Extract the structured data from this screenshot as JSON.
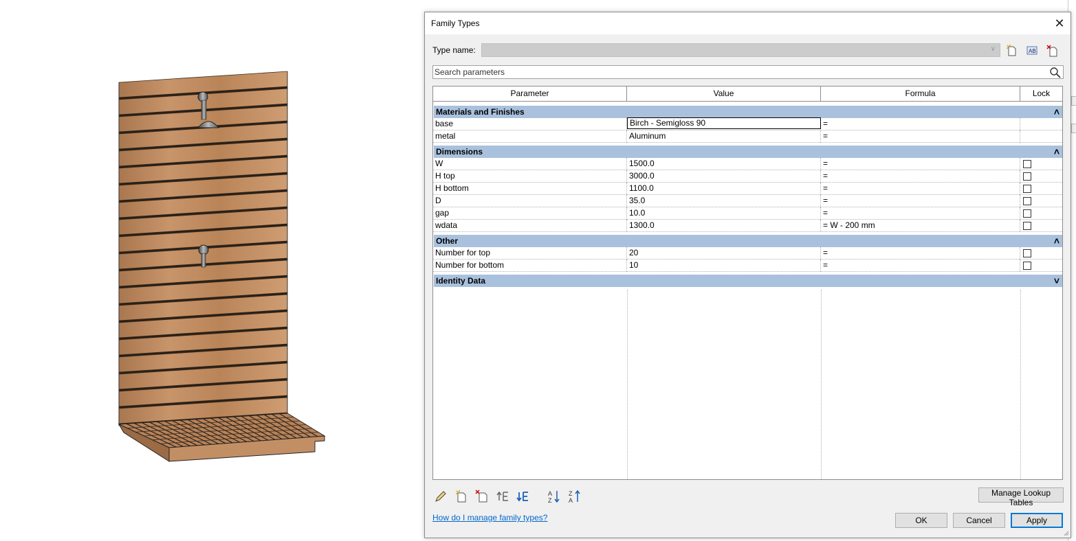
{
  "dialog": {
    "title": "Family Types",
    "close_icon": "close-icon"
  },
  "type_name": {
    "label": "Type name:",
    "value": ""
  },
  "search": {
    "placeholder": "Search parameters"
  },
  "columns": [
    "Parameter",
    "Value",
    "Formula",
    "Lock"
  ],
  "groups": [
    {
      "name": "Materials and Finishes",
      "expanded": true,
      "rows": [
        {
          "parameter": "base",
          "value": "Birch - Semigloss 90",
          "formula": "=",
          "lock": null
        },
        {
          "parameter": "metal",
          "value": "Aluminum",
          "formula": "=",
          "lock": null
        }
      ]
    },
    {
      "name": "Dimensions",
      "expanded": true,
      "rows": [
        {
          "parameter": "W",
          "value": "1500.0",
          "formula": "=",
          "lock": false
        },
        {
          "parameter": "H top",
          "value": "3000.0",
          "formula": "=",
          "lock": false
        },
        {
          "parameter": "H bottom",
          "value": "1100.0",
          "formula": "=",
          "lock": false
        },
        {
          "parameter": "D",
          "value": "35.0",
          "formula": "=",
          "lock": false
        },
        {
          "parameter": "gap",
          "value": "10.0",
          "formula": "=",
          "lock": false
        },
        {
          "parameter": "wdata",
          "value": "1300.0",
          "formula": "= W - 200 mm",
          "lock": false
        }
      ]
    },
    {
      "name": "Other",
      "expanded": true,
      "rows": [
        {
          "parameter": "Number for top",
          "value": "20",
          "formula": "=",
          "lock": false
        },
        {
          "parameter": "Number for bottom",
          "value": "10",
          "formula": "=",
          "lock": false
        }
      ]
    },
    {
      "name": "Identity Data",
      "expanded": false,
      "rows": []
    }
  ],
  "buttons": {
    "manage_lookup": "Manage Lookup Tables",
    "help_link": "How do I manage family types?",
    "ok": "OK",
    "cancel": "Cancel",
    "apply": "Apply"
  },
  "icons": {
    "toolbar": [
      "new-type-icon",
      "rename-type-icon",
      "delete-type-icon"
    ],
    "bottom": [
      "edit-parameter-icon",
      "new-parameter-icon",
      "delete-parameter-icon",
      "move-up-icon",
      "move-down-icon",
      "sort-ascending-icon",
      "sort-descending-icon"
    ]
  },
  "colors": {
    "group_header": "#a9c1dd",
    "dialog_bg": "#f0f0f0",
    "link": "#0066cc",
    "apply_border": "#0078d7"
  }
}
